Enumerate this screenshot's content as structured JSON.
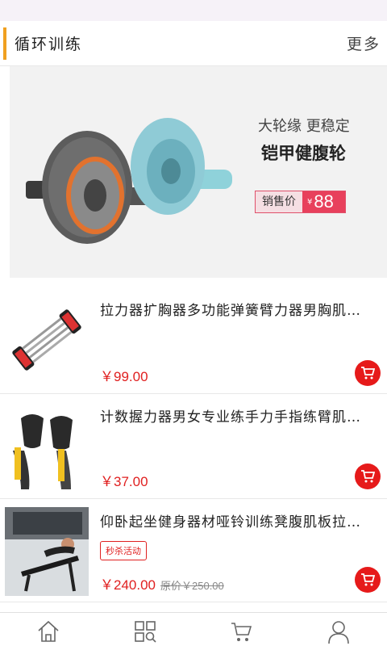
{
  "section": {
    "title": "循环训练",
    "more_label": "更多"
  },
  "banner": {
    "tagline": "大轮缘 更稳定",
    "product_name": "铠甲健腹轮",
    "price_label": "销售价",
    "currency": "¥",
    "price": "88"
  },
  "products": [
    {
      "name": "拉力器扩胸器多功能弹簧臂力器男胸肌…",
      "price": "￥99.00",
      "image": "chest-expander"
    },
    {
      "name": "计数握力器男女专业练手力手指练臂肌…",
      "price": "￥37.00",
      "image": "hand-grip"
    },
    {
      "name": "仰卧起坐健身器材哑铃训练凳腹肌板拉…",
      "badge": "秒杀活动",
      "price": "￥240.00",
      "old_price": "原价￥250.00",
      "image": "sit-up-bench"
    }
  ],
  "tabbar": [
    {
      "icon": "home-icon"
    },
    {
      "icon": "category-icon"
    },
    {
      "icon": "cart-icon"
    },
    {
      "icon": "user-icon"
    }
  ],
  "colors": {
    "accent": "#f0a020",
    "price": "#e02020",
    "cart_button": "#e61a1a",
    "banner_price": "#e8405c"
  }
}
